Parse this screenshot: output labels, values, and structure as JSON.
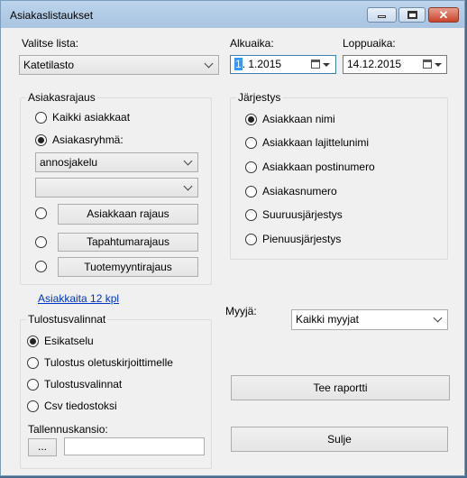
{
  "window": {
    "title": "Asiakaslistaukset"
  },
  "list_select": {
    "label": "Valitse lista:",
    "value": "Katetilasto"
  },
  "start_date": {
    "label": "Alkuaika:",
    "day": "1",
    "rest": ". 1.2015"
  },
  "end_date": {
    "label": "Loppuaika:",
    "value": "14.12.2015"
  },
  "customer_filter": {
    "legend": "Asiakasrajaus",
    "all_customers": "Kaikki asiakkaat",
    "customer_group": "Asiakasryhmä:",
    "group_value": "annosjakelu",
    "second_value": "",
    "buttons": [
      "Asiakkaan rajaus",
      "Tapahtumarajaus",
      "Tuotemyyntirajaus"
    ]
  },
  "order": {
    "legend": "Järjestys",
    "options": [
      "Asiakkaan nimi",
      "Asiakkaan lajittelunimi",
      "Asiakkaan postinumero",
      "Asiakasnumero",
      "Suuruusjärjestys",
      "Pienuusjärjestys"
    ]
  },
  "customer_count_link": "Asiakkaita 12 kpl",
  "output": {
    "legend": "Tulostusvalinnat",
    "options": [
      "Esikatselu",
      "Tulostus oletuskirjoittimelle",
      "Tulostusvalinnat",
      "Csv tiedostoksi"
    ],
    "save_folder_label": "Tallennuskansio:",
    "browse_label": "...",
    "folder_value": ""
  },
  "seller": {
    "label": "Myyjä:",
    "value": "Kaikki myyjat"
  },
  "actions": {
    "report_label": "Tee raportti",
    "close_label": "Sulje"
  }
}
